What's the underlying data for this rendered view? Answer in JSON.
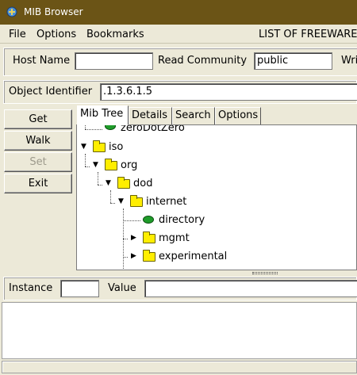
{
  "window": {
    "title": "MIB Browser",
    "icon": "snmp-app-icon"
  },
  "menu": {
    "items": [
      "File",
      "Options",
      "Bookmarks"
    ],
    "banner": "LIST OF FREEWARE"
  },
  "host": {
    "host_label": "Host Name",
    "host_value": "",
    "community_label": "Read Community",
    "community_value": "public",
    "write_label": "Writ"
  },
  "oid": {
    "label": "Object Identifier",
    "value": ".1.3.6.1.5"
  },
  "buttons": {
    "get": "Get",
    "walk": "Walk",
    "set": "Set",
    "exit": "Exit"
  },
  "tabs": [
    "Mib Tree",
    "Details",
    "Search",
    "Options"
  ],
  "tree": {
    "nodes": [
      {
        "label": "zeroDotZero",
        "kind": "leaf"
      },
      {
        "label": "iso",
        "kind": "folder",
        "state": "expanded"
      },
      {
        "label": "org",
        "kind": "folder",
        "state": "expanded"
      },
      {
        "label": "dod",
        "kind": "folder",
        "state": "expanded"
      },
      {
        "label": "internet",
        "kind": "folder",
        "state": "expanded"
      },
      {
        "label": "directory",
        "kind": "leaf"
      },
      {
        "label": "mgmt",
        "kind": "folder",
        "state": "collapsed"
      },
      {
        "label": "experimental",
        "kind": "folder",
        "state": "collapsed"
      }
    ]
  },
  "instance": {
    "label": "Instance",
    "value": "",
    "value_label": "Value",
    "value_field": ""
  },
  "colors": {
    "titlebar": "#6b5416",
    "panel": "#ece9d8",
    "folder": "#ffee00",
    "leaf": "#1f9c2a"
  }
}
